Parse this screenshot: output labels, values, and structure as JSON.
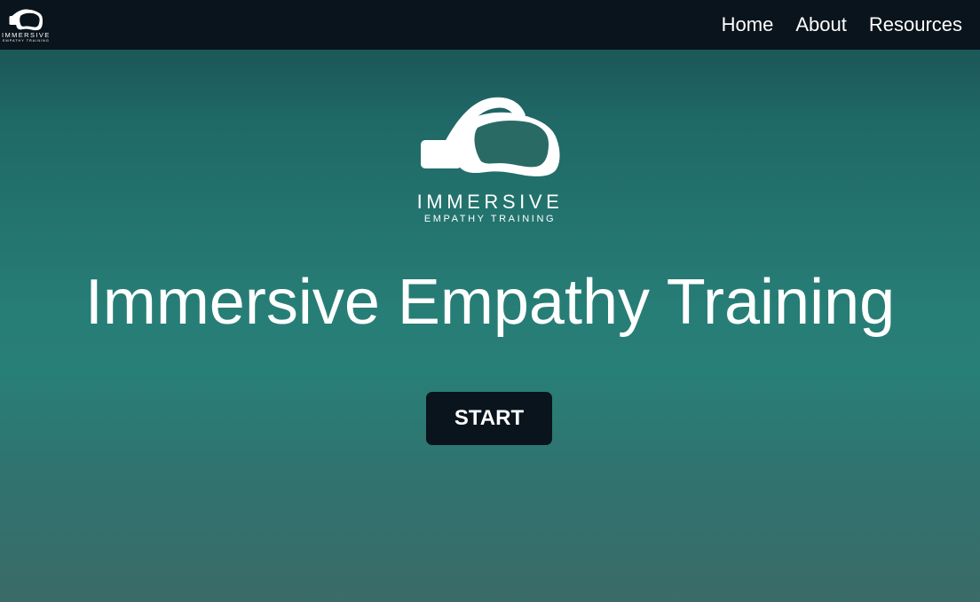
{
  "brand": {
    "name": "IMMERSIVE",
    "tagline": "EMPATHY TRAINING",
    "icon": "vr-headset-icon"
  },
  "nav": {
    "items": [
      {
        "label": "Home"
      },
      {
        "label": "About"
      },
      {
        "label": "Resources"
      }
    ]
  },
  "hero": {
    "title": "Immersive Empathy Training",
    "cta_label": "START"
  },
  "colors": {
    "navbar_bg": "#09141d",
    "gradient_top": "#194c4e",
    "gradient_mid": "#287f77",
    "gradient_bottom": "#3a6b68",
    "button_bg": "#09141d",
    "text": "#ffffff"
  }
}
